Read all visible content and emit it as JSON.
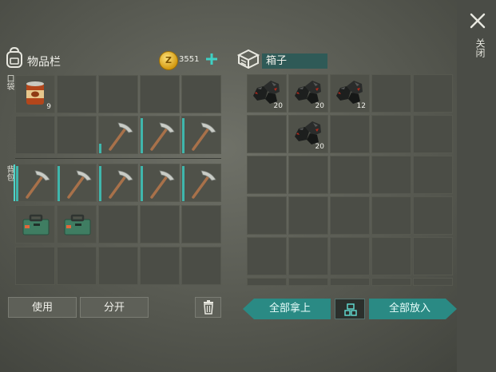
{
  "close": {
    "label": "关闭"
  },
  "inventory": {
    "title": "物品栏",
    "coins": "3551",
    "pocket_tab": "口袋",
    "backpack_tab": "背包",
    "counts": {
      "can": "9"
    }
  },
  "actions": {
    "use_label": "使用",
    "split_label": "分开"
  },
  "chest": {
    "name": "箱子",
    "counts": [
      "20",
      "20",
      "12",
      "20"
    ],
    "take_all_label": "全部拿上",
    "put_all_label": "全部放入"
  },
  "colors": {
    "accent": "#3fb6ac",
    "slot": "#4b4d46",
    "coin": "#e6b12a"
  },
  "icons": [
    "backpack-icon",
    "coin-icon",
    "plus-icon",
    "chest-icon",
    "trash-icon",
    "close-icon",
    "sort-icon",
    "pickaxe-icon",
    "canned-food-icon",
    "coal-icon",
    "toolbox-icon"
  ]
}
